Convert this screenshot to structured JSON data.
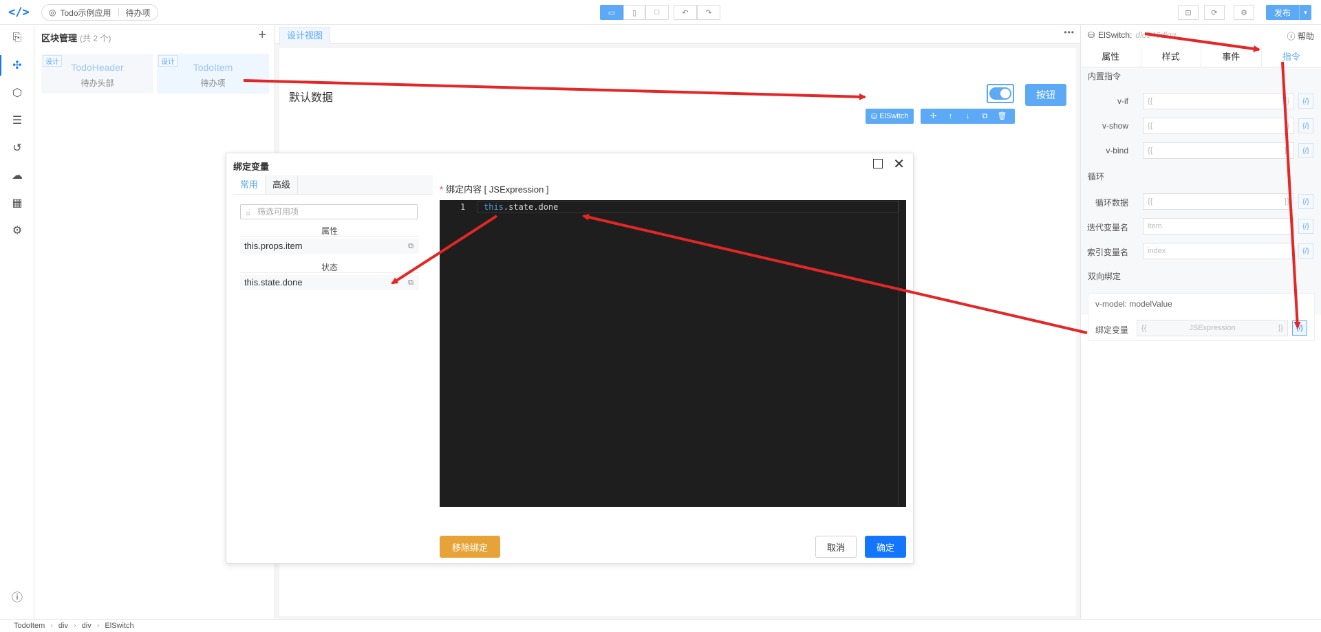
{
  "topbar": {
    "app_name": "Todo示例应用",
    "page_name": "待办项",
    "publish_label": "发布",
    "publish_dropdown": "▾"
  },
  "left_panel": {
    "title": "区块管理",
    "count": "(共 2 个)",
    "add_icon": "+",
    "blocks": [
      {
        "tag": "设计",
        "name": "TodoHeader",
        "desc": "待办头部"
      },
      {
        "tag": "设计",
        "name": "TodoItem",
        "desc": "待办项"
      }
    ]
  },
  "canvas": {
    "tab_label": "设计视图",
    "more": "•••",
    "default_label": "默认数据",
    "button_label": "按钮",
    "selection_label": "ElSwitch"
  },
  "right_panel": {
    "component": "ElSwitch:",
    "component_id": "dlo946dlqq",
    "help_label": "帮助",
    "tabs": [
      "属性",
      "样式",
      "事件",
      "指令"
    ],
    "section_builtin": "内置指令",
    "rows_builtin": [
      {
        "label": "v-if",
        "open": "{{",
        "close": "}}"
      },
      {
        "label": "v-show",
        "open": "{{",
        "close": "}}"
      },
      {
        "label": "v-bind",
        "open": "{{",
        "close": "}}"
      }
    ],
    "section_loop": "循环",
    "rows_loop": [
      {
        "label": "循环数据",
        "placeholder": "{{",
        "close": "}}"
      },
      {
        "label": "迭代变量名",
        "placeholder": "item",
        "close": ""
      },
      {
        "label": "索引变量名",
        "placeholder": "index",
        "close": ""
      }
    ],
    "section_twoway": "双向绑定",
    "vmodel": "v-model: modelValue",
    "bind_var_label": "绑定变量",
    "bind_open": "{{",
    "bind_value": "JSExpression",
    "bind_close": "}}",
    "bind_icon": "{/}"
  },
  "dialog": {
    "title": "绑定变量",
    "tabs": [
      "常用",
      "高级"
    ],
    "filter_placeholder": "筛选可用项",
    "group_props": "属性",
    "item_props": "this.props.item",
    "group_state": "状态",
    "item_state": "this.state.done",
    "content_label": "绑定内容 [ JSExpression ]",
    "line_number": "1",
    "code_kw": "this",
    "code_rest": ".state.done",
    "btn_remove": "移除绑定",
    "btn_cancel": "取消",
    "btn_ok": "确定"
  },
  "breadcrumb": [
    "TodoItem",
    "div",
    "div",
    "ElSwitch"
  ],
  "colors": {
    "accent": "#1476ff",
    "light_accent": "#5ca9f5",
    "warning": "#e8a338",
    "annotation": "#e32626"
  }
}
